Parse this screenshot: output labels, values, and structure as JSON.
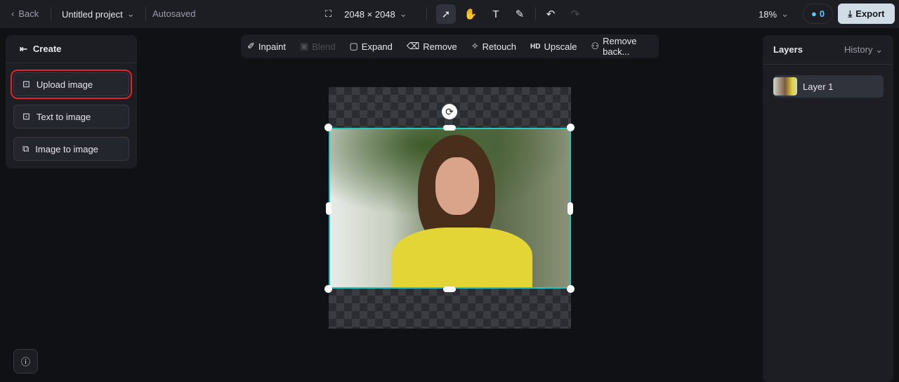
{
  "header": {
    "back": "Back",
    "project": "Untitled project",
    "status": "Autosaved",
    "canvas_size": "2048 × 2048",
    "zoom": "18%",
    "credits": "0",
    "export": "Export"
  },
  "left_panel": {
    "title": "Create",
    "items": [
      {
        "label": "Upload image"
      },
      {
        "label": "Text to image"
      },
      {
        "label": "Image to image"
      }
    ]
  },
  "toolbar": {
    "items": [
      {
        "label": "Inpaint"
      },
      {
        "label": "Blend"
      },
      {
        "label": "Expand"
      },
      {
        "label": "Remove"
      },
      {
        "label": "Retouch"
      },
      {
        "label": "Upscale",
        "badge": "HD"
      },
      {
        "label": "Remove back..."
      }
    ]
  },
  "right_panel": {
    "title": "Layers",
    "history": "History",
    "layers": [
      {
        "label": "Layer 1"
      }
    ]
  },
  "colors": {
    "selection": "#1fc7c7",
    "highlight": "#e0262a",
    "credits": "#5fc6ff"
  }
}
